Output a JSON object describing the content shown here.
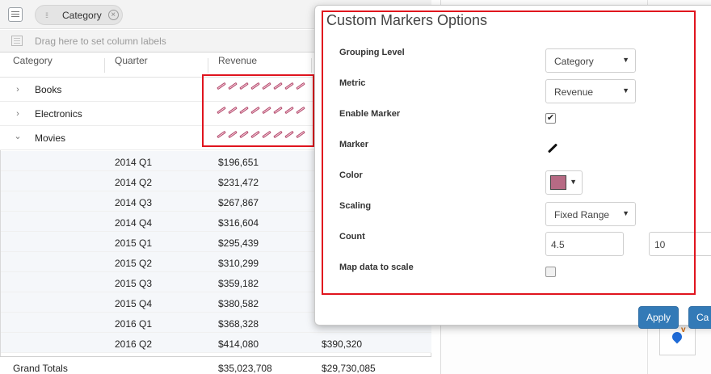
{
  "toolbar": {
    "chip_label": "Category",
    "drag_hint": "Drag here to set column labels"
  },
  "columns": [
    "Category",
    "Quarter",
    "Revenue"
  ],
  "groups": [
    {
      "name": "Books",
      "expander": "›"
    },
    {
      "name": "Electronics",
      "expander": "›"
    },
    {
      "name": "Movies",
      "expander": "⌄"
    }
  ],
  "detail_rows": [
    {
      "quarter": "2014 Q1",
      "revenue": "$196,651",
      "revenue2": ""
    },
    {
      "quarter": "2014 Q2",
      "revenue": "$231,472",
      "revenue2": ""
    },
    {
      "quarter": "2014 Q3",
      "revenue": "$267,867",
      "revenue2": ""
    },
    {
      "quarter": "2014 Q4",
      "revenue": "$316,604",
      "revenue2": ""
    },
    {
      "quarter": "2015 Q1",
      "revenue": "$295,439",
      "revenue2": ""
    },
    {
      "quarter": "2015 Q2",
      "revenue": "$310,299",
      "revenue2": ""
    },
    {
      "quarter": "2015 Q3",
      "revenue": "$359,182",
      "revenue2": ""
    },
    {
      "quarter": "2015 Q4",
      "revenue": "$380,582",
      "revenue2": ""
    },
    {
      "quarter": "2016 Q1",
      "revenue": "$368,328",
      "revenue2": ""
    },
    {
      "quarter": "2016 Q2",
      "revenue": "$414,080",
      "revenue2": "$390,320"
    }
  ],
  "totals": {
    "label": "Grand Totals",
    "revenue": "$35,023,708",
    "revenue2": "$29,730,085"
  },
  "dialog": {
    "title": "Custom Markers Options",
    "grouping_level": {
      "label": "Grouping Level",
      "value": "Category"
    },
    "metric": {
      "label": "Metric",
      "value": "Revenue"
    },
    "enable_marker": {
      "label": "Enable Marker",
      "checked": "✔"
    },
    "marker": {
      "label": "Marker",
      "icon": "pencil-icon"
    },
    "color": {
      "label": "Color",
      "value": "#b76a84"
    },
    "scaling": {
      "label": "Scaling",
      "value": "Fixed Range"
    },
    "count": {
      "label": "Count",
      "min": "4.5",
      "max": "10"
    },
    "map_to_scale": {
      "label": "Map data to scale"
    },
    "apply_label": "Apply",
    "cancel_label": "Ca"
  },
  "colors": {
    "marker": "#b24d6e",
    "highlight": "#e0141e",
    "primary": "#337ab7"
  }
}
